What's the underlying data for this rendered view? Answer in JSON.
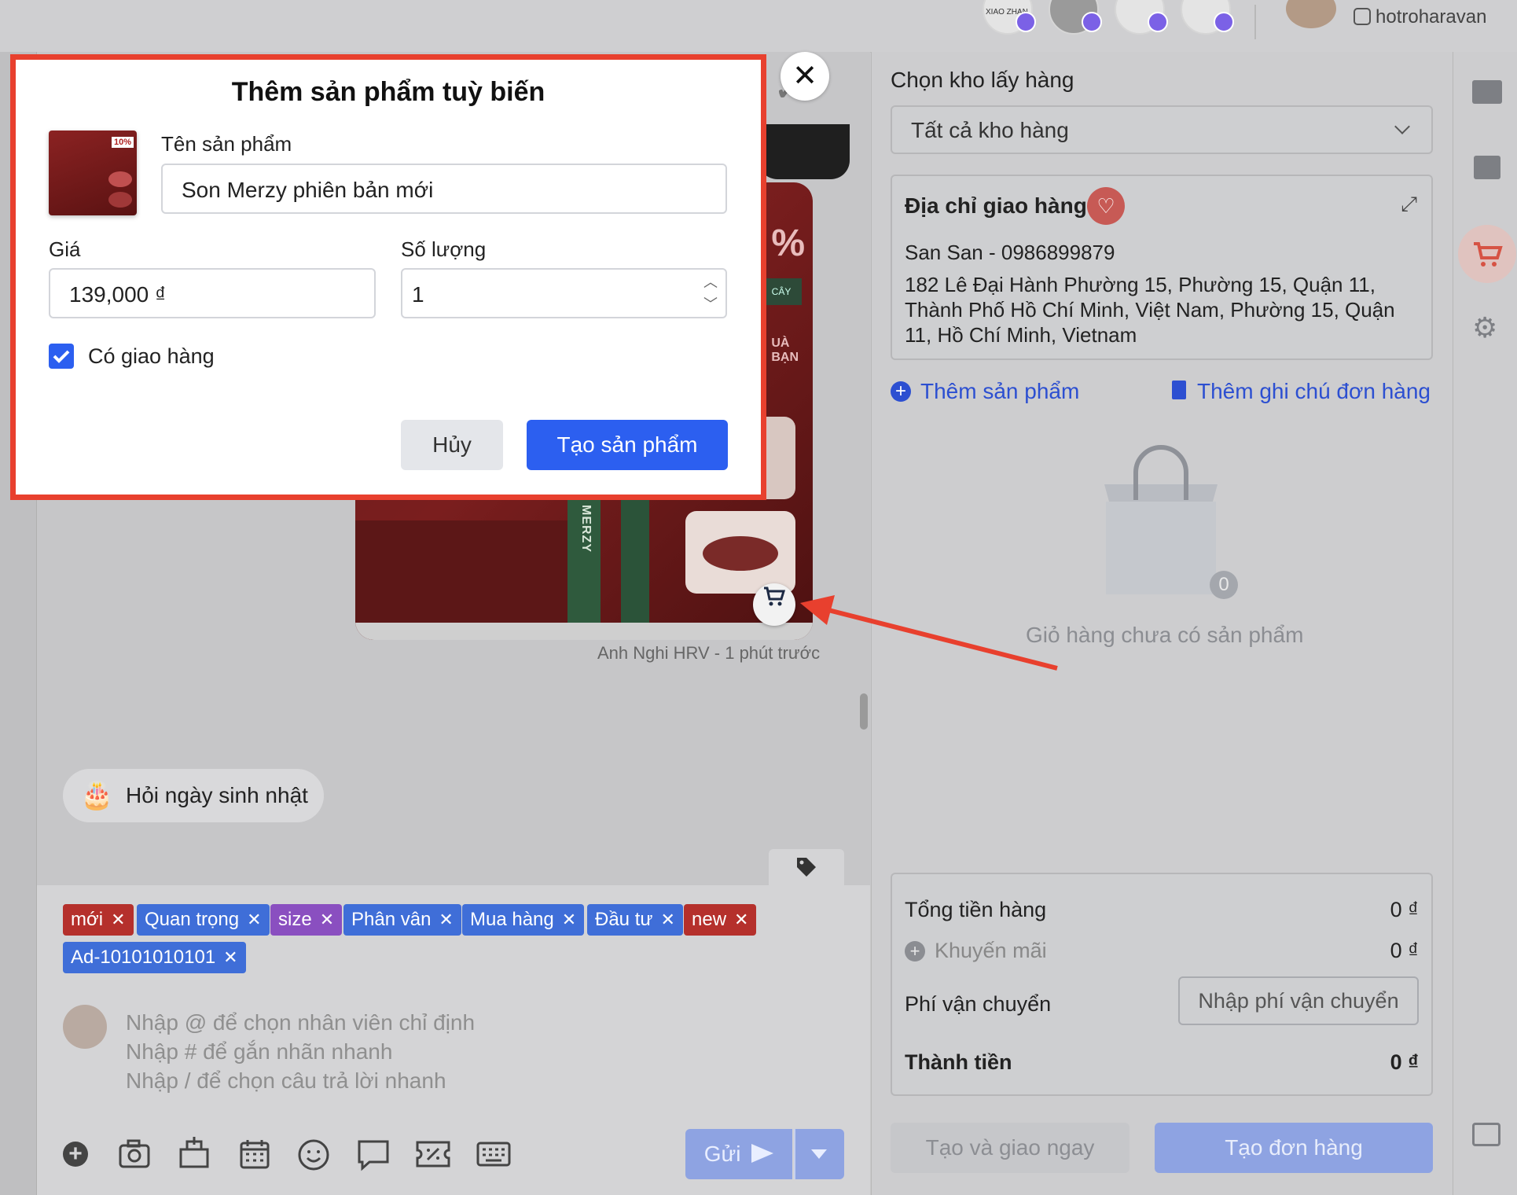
{
  "topbar": {
    "page_avatars": [
      {
        "label": "XIAO ZHAN"
      },
      {
        "label": ""
      },
      {
        "label": ""
      },
      {
        "label": ""
      }
    ],
    "account_name": "hotroharavan"
  },
  "chat": {
    "sender_line": "Anh Nghi HRV - 1 phút trước",
    "birthday_chip": "Hỏi ngày sinh nhật",
    "promo_text": "%",
    "promo_sub": "CÂY",
    "promo_sub2": "UÀ\nBẠN",
    "brand_text": "MERZY"
  },
  "tags": [
    {
      "label": "mới",
      "color": "#b5302c"
    },
    {
      "label": "Quan trọng",
      "color": "#3f6ed8"
    },
    {
      "label": "size",
      "color": "#8a4fc0"
    },
    {
      "label": "Phân vân",
      "color": "#3f6ed8"
    },
    {
      "label": "Mua hàng",
      "color": "#3f6ed8"
    },
    {
      "label": "Đầu tư",
      "color": "#3f6ed8"
    },
    {
      "label": "new",
      "color": "#b5302c"
    },
    {
      "label": "Ad-10101010101",
      "color": "#3f6ed8"
    }
  ],
  "composer": {
    "hint1": "Nhập @ để chọn nhân viên chỉ định",
    "hint2": "Nhập # để gắn nhãn nhanh",
    "hint3": "Nhập / để chọn câu trả lời nhanh",
    "send_label": "Gửi",
    "toolbar_icons": [
      "plus-icon",
      "camera-icon",
      "product-icon",
      "calendar-icon",
      "emoji-icon",
      "comment-icon",
      "discount-icon",
      "keyboard-icon"
    ]
  },
  "order": {
    "warehouse_label": "Chọn kho lấy hàng",
    "warehouse_value": "Tất cả kho hàng",
    "address_title": "Địa chỉ giao hàng",
    "customer": "San San - 0986899879",
    "address": "182 Lê Đại Hành Phường 15, Phường 15, Quận 11, Thành Phố Hồ Chí Minh, Việt Nam, Phường 15, Quận 11, Hồ Chí Minh, Vietnam",
    "add_product": "Thêm sản phẩm",
    "add_note": "Thêm ghi chú đơn hàng",
    "cart_count": "0",
    "cart_empty": "Giỏ hàng chưa có sản phẩm",
    "subtotal_label": "Tổng tiền hàng",
    "subtotal_value": "0 ₫",
    "discount_label": "Khuyến mãi",
    "discount_value": "0 ₫",
    "shipping_label": "Phí vận chuyển",
    "shipping_placeholder": "Nhập phí vận chuyển",
    "total_label": "Thành tiền",
    "total_value": "0 ₫",
    "create_ship_btn": "Tạo và giao ngay",
    "create_order_btn": "Tạo đơn hàng"
  },
  "modal": {
    "title": "Thêm sản phẩm tuỳ biến",
    "name_label": "Tên sản phẩm",
    "name_value": "Son Merzy phiên bản mới",
    "price_label": "Giá",
    "price_value": "139,000 ₫",
    "qty_label": "Số lượng",
    "qty_value": "1",
    "shipping_checkbox": "Có giao hàng",
    "shipping_checked": true,
    "cancel_btn": "Hủy",
    "create_btn": "Tạo sản phẩm",
    "thumb_badge": "10%"
  },
  "colors": {
    "accent": "#2c5ff0",
    "highlight_border": "#e8402e",
    "annotation_arrow": "#e8402e"
  }
}
